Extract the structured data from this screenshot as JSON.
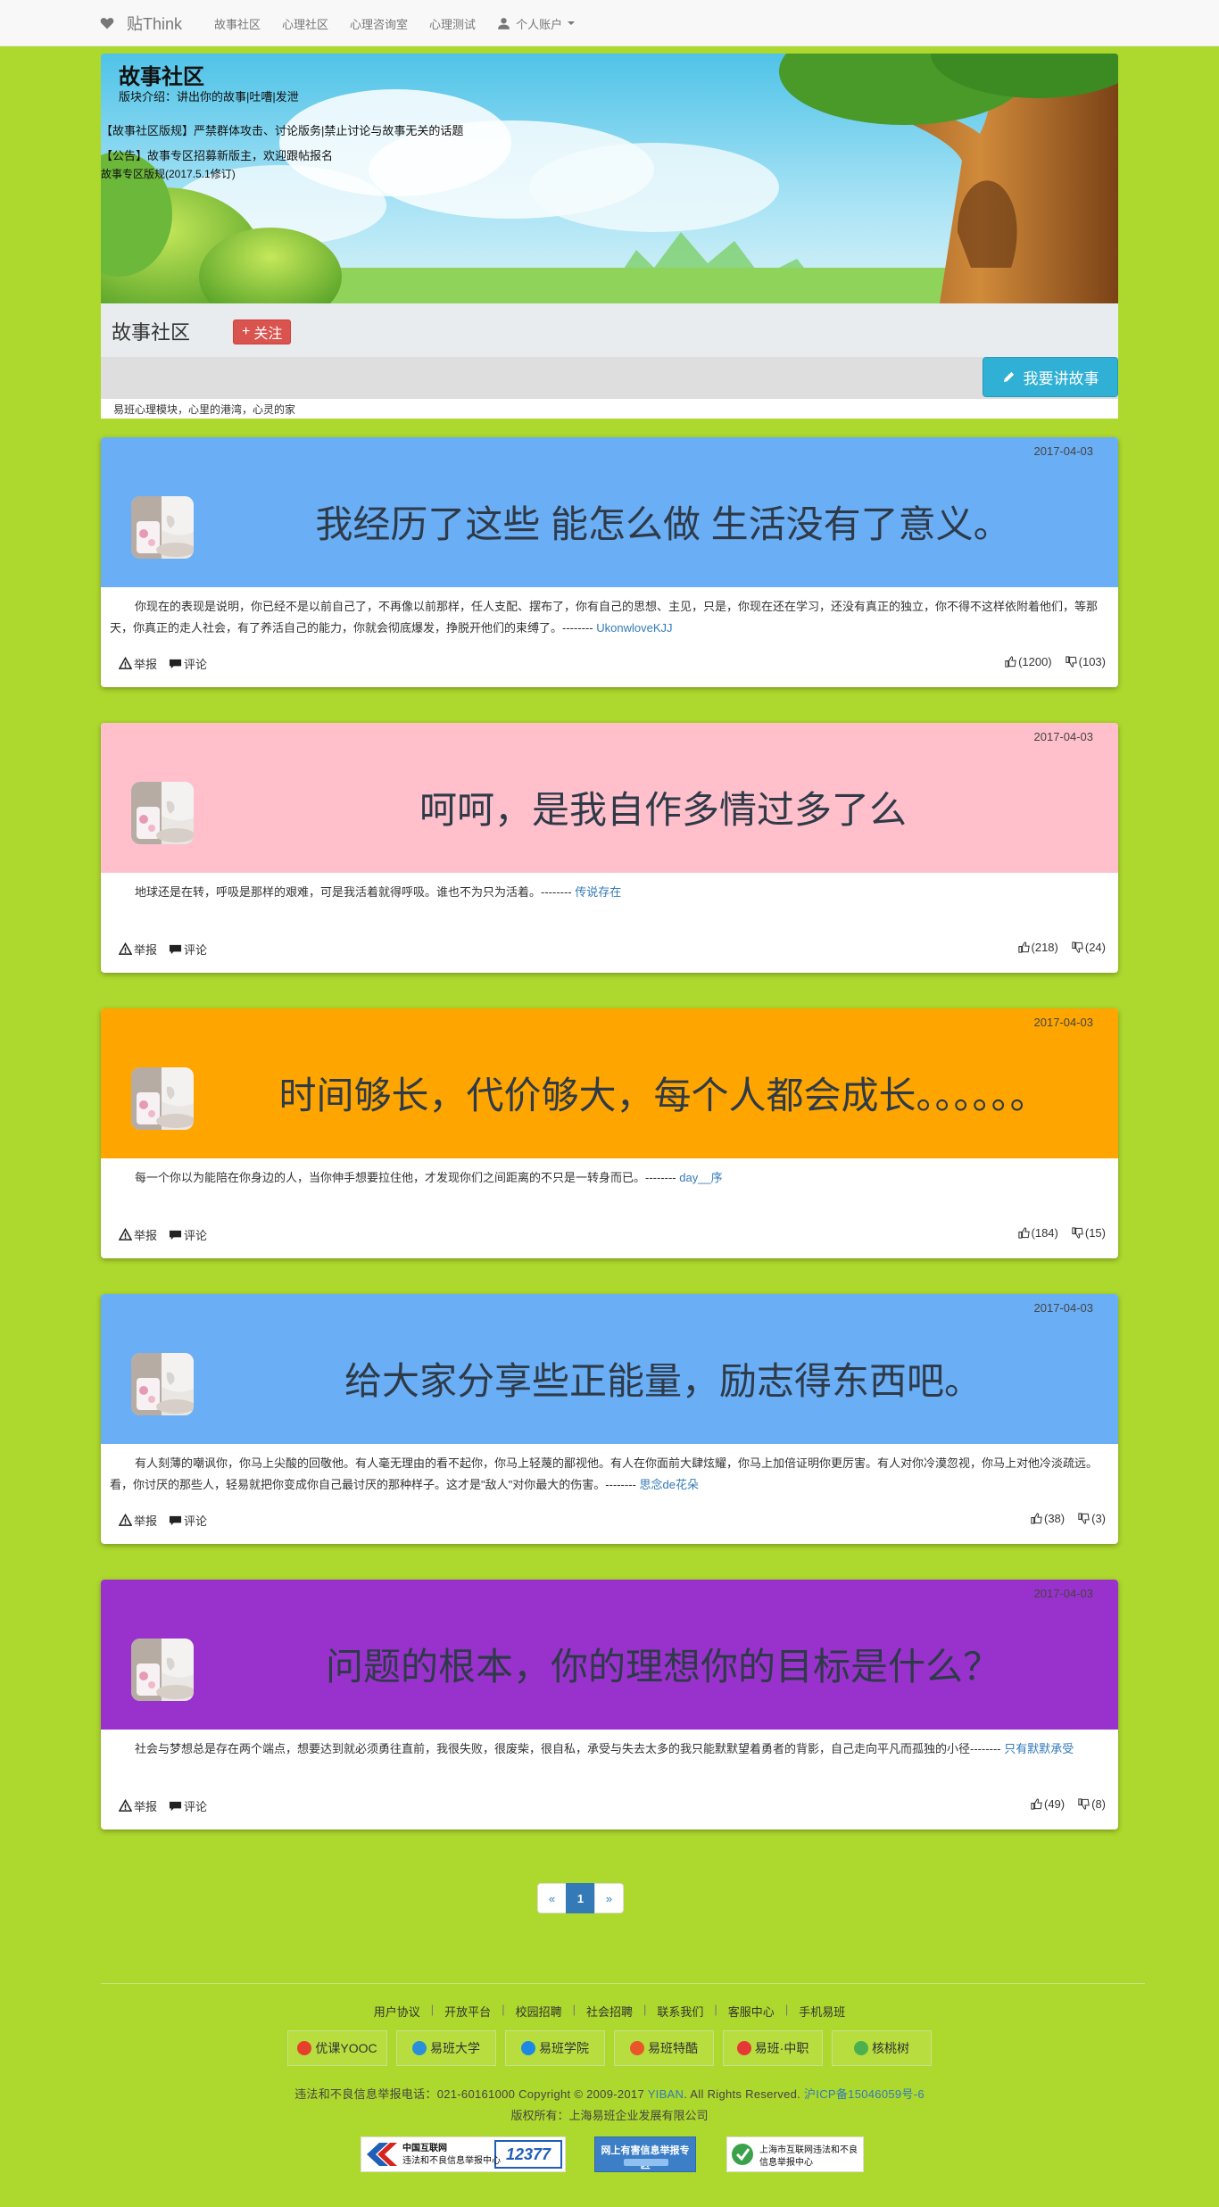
{
  "nav": {
    "brand": "贴Think",
    "items": [
      {
        "label": "故事社区"
      },
      {
        "label": "心理社区"
      },
      {
        "label": "心理咨询室"
      },
      {
        "label": "心理测试"
      }
    ],
    "account": "个人账户"
  },
  "forum": {
    "title": "故事社区",
    "intro": "版块介绍：讲出你的故事|吐嘈|发泄",
    "rule": "【故事社区版规】严禁群体攻击、讨论版务|禁止讨论与故事无关的话题",
    "notice": "【公告】故事专区招募新版主，欢迎跟帖报名",
    "version": "故事专区版规(2017.5.1修订)",
    "name": "故事社区",
    "follow_label": "关注",
    "follow_plus": "+",
    "story_button": "我要讲故事",
    "slogan": "易班心理模块，心里的港湾，心灵的家"
  },
  "posts": [
    {
      "date": "2017-04-03",
      "color": "#6aaef5",
      "title": "我经历了这些 能怎么做 生活没有了意义。",
      "body": "你现在的表现是说明，你已经不是以前自己了，不再像以前那样，任人支配、摆布了，你有自己的思想、主见，只是，你现在还在学习，还没有真正的独立，你不得不这样依附着他们，等那天，你真正的走人社会，有了养活自己的能力，你就会彻底爆发，挣脱开他们的束缚了。--------",
      "author": "UkonwloveKJJ",
      "report": "举报",
      "comment": "评论",
      "up": "(1200)",
      "down": "(103)"
    },
    {
      "date": "2017-04-03",
      "color": "#ffc0cb",
      "title": "呵呵，是我自作多情过多了么",
      "body": "地球还是在转，呼吸是那样的艰难，可是我活着就得呼吸。谁也不为只为活着。--------",
      "author": "传说存在",
      "report": "举报",
      "comment": "评论",
      "up": "(218)",
      "down": "(24)"
    },
    {
      "date": "2017-04-03",
      "color": "#ffa500",
      "title": "时间够长，代价够大，每个人都会成长。。。。。。",
      "body": "每一个你以为能陪在你身边的人，当你伸手想要拉住他，才发现你们之间距离的不只是一转身而已。--------",
      "author": "day__序",
      "report": "举报",
      "comment": "评论",
      "up": "(184)",
      "down": "(15)"
    },
    {
      "date": "2017-04-03",
      "color": "#6aaef5",
      "title": "给大家分享些正能量，励志得东西吧。",
      "body": "有人刻薄的嘲讽你，你马上尖酸的回敬他。有人毫无理由的看不起你，你马上轻蔑的鄙视他。有人在你面前大肆炫耀，你马上加倍证明你更厉害。有人对你冷漠忽视，你马上对他冷淡疏远。看，你讨厌的那些人，轻易就把你变成你自己最讨厌的那种样子。这才是\"敌人\"对你最大的伤害。--------",
      "author": "思念de花朵",
      "report": "举报",
      "comment": "评论",
      "up": "(38)",
      "down": "(3)"
    },
    {
      "date": "2017-04-03",
      "color": "#9932cc",
      "title": "问题的根本，你的理想你的目标是什么？",
      "body": "社会与梦想总是存在两个端点，想要达到就必须勇往直前，我很失败，很废柴，很自私，承受与失去太多的我只能默默望着勇者的背影，自己走向平凡而孤独的小径--------",
      "author": "只有默默承受",
      "report": "举报",
      "comment": "评论",
      "up": "(49)",
      "down": "(8)"
    }
  ],
  "pagination": {
    "prev": "«",
    "current": "1",
    "next": "»"
  },
  "footer": {
    "links": [
      "用户协议",
      "开放平台",
      "校园招聘",
      "社会招聘",
      "联系我们",
      "客服中心",
      "手机易班"
    ],
    "partners": [
      {
        "label": "优课YOOC",
        "color": "#e6402c"
      },
      {
        "label": "易班大学",
        "color": "#2a8fd8"
      },
      {
        "label": "易班学院",
        "color": "#1e88e5"
      },
      {
        "label": "易班特酷",
        "color": "#e8562a"
      },
      {
        "label": "易班·中职",
        "color": "#e53935"
      },
      {
        "label": "核桃树",
        "color": "#4caf50"
      }
    ],
    "copyright_prefix": "违法和不良信息举报电话：021-60161000 Copyright © 2009-2017",
    "yiban": "YIBAN",
    "rights": ". All Rights Reserved.",
    "icp": "沪ICP备15046059号-6",
    "owner": "版权所有：上海易班企业发展有限公司",
    "badges": [
      {
        "title": "中国互联网",
        "sub": "违法和不良信息举报中心",
        "num": "12377"
      },
      {
        "title": "网上有害信息举报专区",
        "sub": ""
      },
      {
        "title": "上海市互联网违法和不良",
        "sub": "信息举报中心"
      }
    ]
  }
}
